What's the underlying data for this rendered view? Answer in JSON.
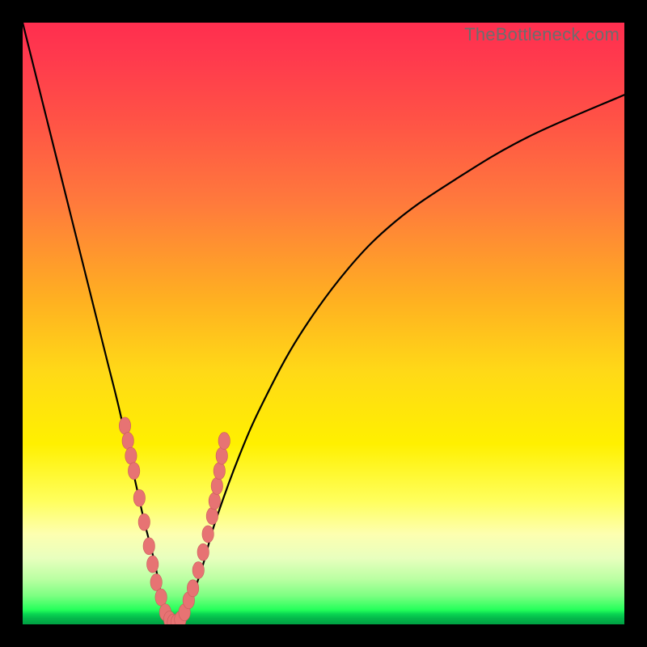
{
  "watermark": "TheBottleneck.com",
  "colors": {
    "background": "#000000",
    "curve_stroke": "#000000",
    "marker_fill": "#e77373",
    "marker_stroke": "#c95b5b"
  },
  "chart_data": {
    "type": "line",
    "title": "",
    "xlabel": "",
    "ylabel": "",
    "xlim": [
      0,
      100
    ],
    "ylim": [
      0,
      100
    ],
    "series": [
      {
        "name": "bottleneck-curve",
        "x": [
          0,
          2,
          4,
          6,
          8,
          10,
          12,
          14,
          16,
          18,
          20,
          21,
          22,
          23,
          24,
          25,
          26,
          27,
          28,
          30,
          32,
          36,
          40,
          46,
          54,
          62,
          72,
          84,
          100
        ],
        "values": [
          100,
          92,
          84,
          76,
          68,
          60,
          52,
          44,
          36,
          27,
          18,
          14,
          10,
          5,
          1,
          0,
          0,
          1,
          4,
          10,
          17,
          28,
          37,
          48,
          59,
          67,
          74,
          81,
          88
        ]
      }
    ],
    "markers": [
      {
        "x": 17.0,
        "y": 33.0
      },
      {
        "x": 17.5,
        "y": 30.5
      },
      {
        "x": 18.0,
        "y": 28.0
      },
      {
        "x": 18.5,
        "y": 25.5
      },
      {
        "x": 19.4,
        "y": 21.0
      },
      {
        "x": 20.2,
        "y": 17.0
      },
      {
        "x": 21.0,
        "y": 13.0
      },
      {
        "x": 21.6,
        "y": 10.0
      },
      {
        "x": 22.2,
        "y": 7.0
      },
      {
        "x": 23.0,
        "y": 4.5
      },
      {
        "x": 23.7,
        "y": 2.0
      },
      {
        "x": 24.4,
        "y": 0.8
      },
      {
        "x": 25.0,
        "y": 0.3
      },
      {
        "x": 25.6,
        "y": 0.3
      },
      {
        "x": 26.2,
        "y": 0.8
      },
      {
        "x": 26.9,
        "y": 2.0
      },
      {
        "x": 27.6,
        "y": 4.0
      },
      {
        "x": 28.3,
        "y": 6.0
      },
      {
        "x": 29.2,
        "y": 9.0
      },
      {
        "x": 30.0,
        "y": 12.0
      },
      {
        "x": 30.8,
        "y": 15.0
      },
      {
        "x": 31.5,
        "y": 18.0
      },
      {
        "x": 31.9,
        "y": 20.5
      },
      {
        "x": 32.3,
        "y": 23.0
      },
      {
        "x": 32.7,
        "y": 25.5
      },
      {
        "x": 33.1,
        "y": 28.0
      },
      {
        "x": 33.5,
        "y": 30.5
      }
    ],
    "background_gradient": {
      "direction": "top-to-bottom",
      "stops": [
        {
          "pos": 0.0,
          "color": "#ff2e4f"
        },
        {
          "pos": 0.3,
          "color": "#ff7a3c"
        },
        {
          "pos": 0.58,
          "color": "#ffd917"
        },
        {
          "pos": 0.8,
          "color": "#ffff5d"
        },
        {
          "pos": 0.95,
          "color": "#7bff81"
        },
        {
          "pos": 1.0,
          "color": "#00a043"
        }
      ]
    }
  }
}
